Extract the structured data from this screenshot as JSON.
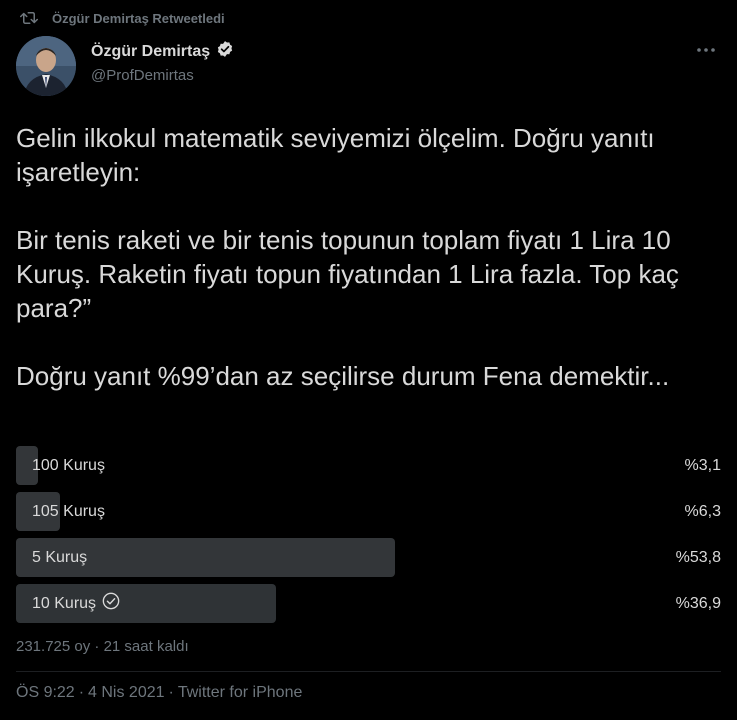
{
  "retweet": {
    "text": "Özgür Demirtaş Retweetledi",
    "icon": "retweet-icon"
  },
  "author": {
    "name": "Özgür Demirtaş",
    "handle": "@ProfDemirtas",
    "verified_icon": "verified-badge-icon",
    "more_icon": "more-options-icon"
  },
  "tweet": {
    "paragraph_1": "Gelin ilkokul matematik seviyemizi ölçelim. Doğru yanıtı işaretleyin:",
    "paragraph_2": "Bir tenis raketi ve bir tenis topunun toplam fiyatı 1 Lira 10 Kuruş. Raketin fiyatı topun fiyatından 1 Lira fazla. Top kaç para?”",
    "paragraph_3": "Doğru yanıt %99’dan az seçilirse durum Fena demektir..."
  },
  "poll": {
    "options": [
      {
        "label": "100 Kuruş",
        "percent_text": "%3,1",
        "percent": 3.1,
        "selected": false
      },
      {
        "label": "105 Kuruş",
        "percent_text": "%6,3",
        "percent": 6.3,
        "selected": false
      },
      {
        "label": "5 Kuruş",
        "percent_text": "%53,8",
        "percent": 53.8,
        "selected": false
      },
      {
        "label": "10 Kuruş",
        "percent_text": "%36,9",
        "percent": 36.9,
        "selected": true
      }
    ],
    "votes": "231.725 oy",
    "separator": "·",
    "time_left": "21 saat kaldı"
  },
  "meta": {
    "time": "ÖS 9:22",
    "separator": "·",
    "date": "4 Nis 2021",
    "source": "Twitter for iPhone"
  },
  "colors": {
    "background": "#000000",
    "text": "#d9d9d9",
    "muted": "#6e767d",
    "poll_bar": "#333639"
  }
}
